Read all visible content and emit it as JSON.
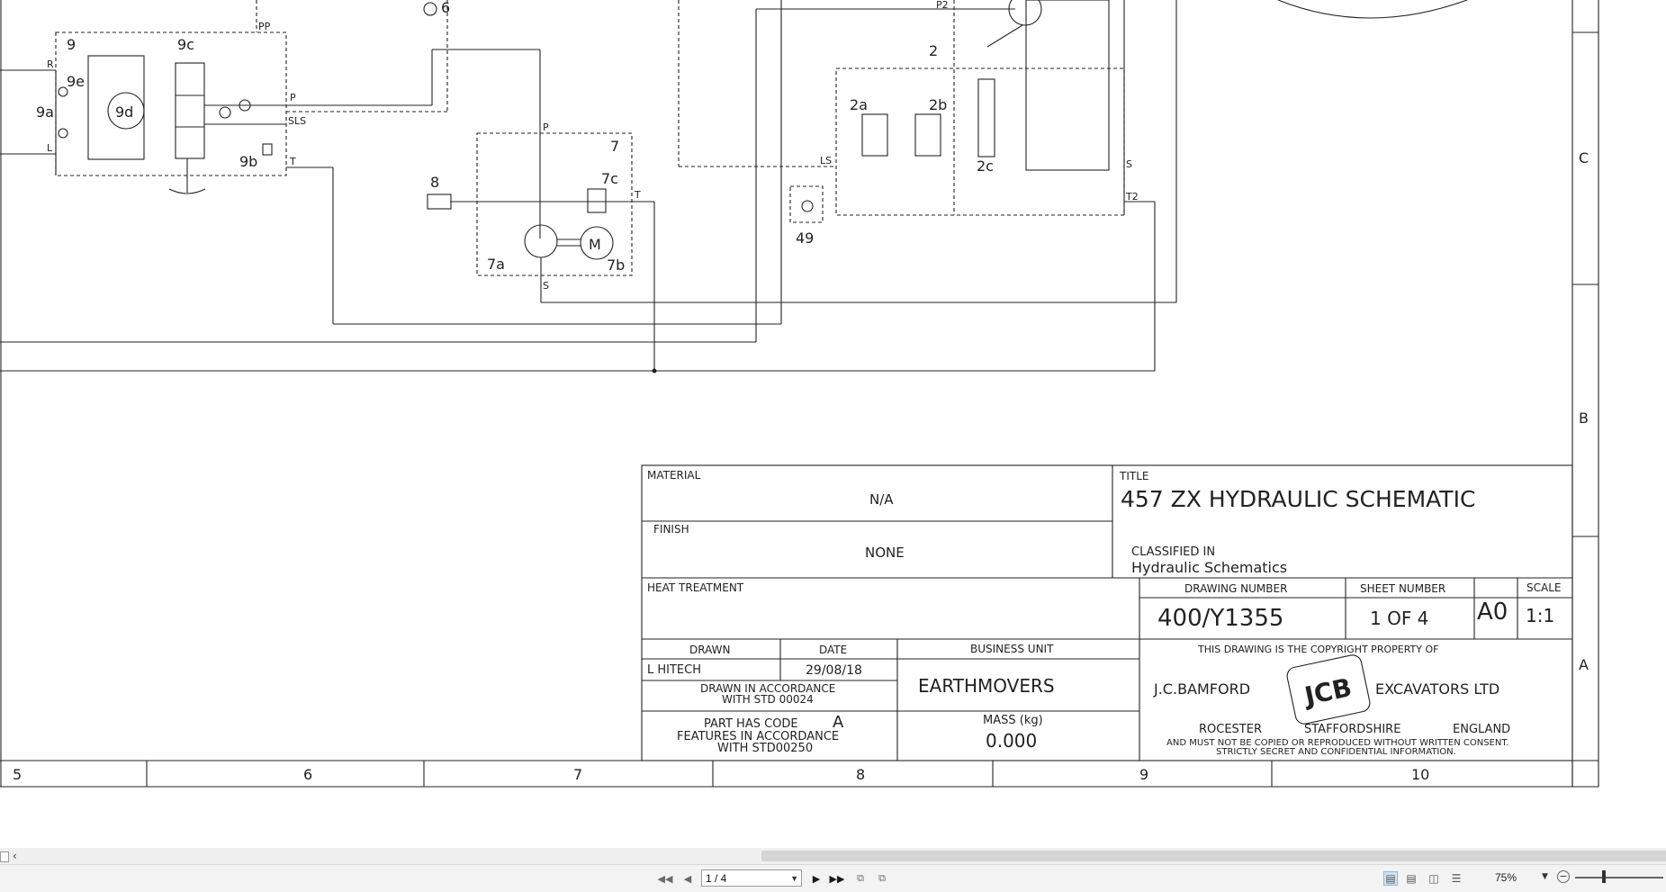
{
  "drawing": {
    "labels": {
      "v9": "9",
      "v9c": "9c",
      "v9e": "9e",
      "v9a": "9a",
      "v9d": "9d",
      "v9b": "9b",
      "pR": "R",
      "pL": "L",
      "pP": "P",
      "pSLS": "SLS",
      "pT": "T",
      "pPP": "PP",
      "v6": "6",
      "v8": "8",
      "v7": "7",
      "v7c": "7c",
      "v7a": "7a",
      "v7b": "7b",
      "pP2": "P",
      "pS2": "S",
      "pT2": "T",
      "motorM": "M",
      "pP2top": "P2",
      "v2": "2",
      "v2a": "2a",
      "v2b": "2b",
      "v2c": "2c",
      "pLS": "LS",
      "pS3": "S",
      "pT2b": "T2",
      "v49": "49"
    },
    "zone_letters": [
      "C",
      "B",
      "A"
    ],
    "column_numbers": [
      "5",
      "6",
      "7",
      "8",
      "9",
      "10"
    ],
    "title_block": {
      "material_label": "MATERIAL",
      "material_value": "N/A",
      "finish_label": "FINISH",
      "finish_value": "NONE",
      "heat_label": "HEAT TREATMENT",
      "title_label": "TITLE",
      "title_value": "457 ZX HYDRAULIC SCHEMATIC",
      "classified_label": "CLASSIFIED IN",
      "classified_value": "Hydraulic Schematics",
      "drawing_number_label": "DRAWING NUMBER",
      "drawing_number_value": "400/Y1355",
      "sheet_number_label": "SHEET NUMBER",
      "sheet_number_value": "1 OF 4",
      "size_value": "A0",
      "scale_label": "SCALE",
      "scale_value": "1:1",
      "drawn_label": "DRAWN",
      "drawn_value": "L HITECH",
      "date_label": "DATE",
      "date_value": "29/08/18",
      "business_unit_label": "BUSINESS UNIT",
      "business_unit_value": "EARTHMOVERS",
      "accordance_line1": "DRAWN IN ACCORDANCE",
      "accordance_line2": "WITH STD 00024",
      "part_code_line1": "PART HAS CODE",
      "part_code_letter": "A",
      "part_code_line2": "FEATURES IN ACCORDANCE",
      "part_code_line3": "WITH STD00250",
      "mass_label": "MASS (kg)",
      "mass_value": "0.000",
      "copyright_line": "THIS DRAWING IS THE COPYRIGHT PROPERTY OF",
      "company_left": "J.C.BAMFORD",
      "logo_text": "JCB",
      "company_right": "EXCAVATORS LTD",
      "address_1": "ROCESTER",
      "address_2": "STAFFORDSHIRE",
      "address_3": "ENGLAND",
      "notice_1": "AND MUST NOT BE COPIED OR REPRODUCED WITHOUT WRITTEN CONSENT.",
      "notice_2": "STRICTLY SECRET AND CONFIDENTIAL INFORMATION."
    }
  },
  "toolbar": {
    "page_value": "1 / 4",
    "zoom_value": "75%",
    "icons": [
      "first-page-icon",
      "prev-page-icon",
      "next-page-icon",
      "last-page-icon",
      "extract-page-icon",
      "insert-page-icon",
      "single-page-view-icon",
      "continuous-view-icon",
      "two-page-view-icon",
      "columns-view-icon",
      "zoom-out-icon"
    ]
  }
}
